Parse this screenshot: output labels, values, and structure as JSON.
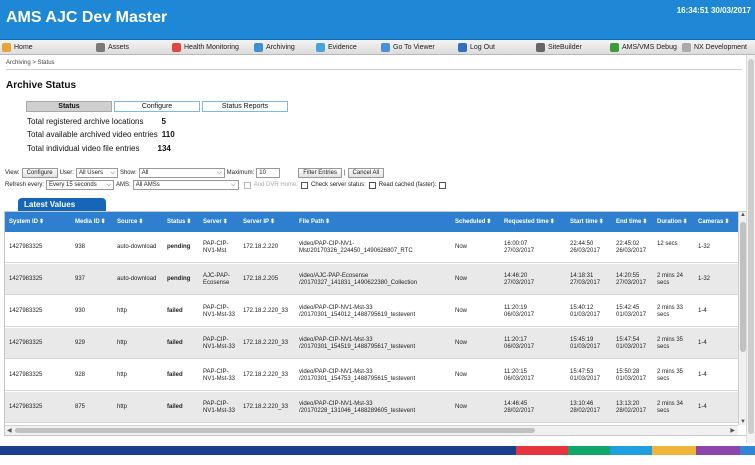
{
  "app": {
    "title": "AMS AJC Dev Master",
    "clock": "16:34:51 30/03/2017"
  },
  "nav": [
    {
      "label": "Home",
      "icon": "home-icon",
      "color": "#e8a33a"
    },
    {
      "label": "Assets",
      "icon": "assets-icon",
      "color": "#7a7a7a"
    },
    {
      "label": "Health Monitoring",
      "icon": "heart-icon",
      "color": "#e2463f"
    },
    {
      "label": "Archiving",
      "icon": "archive-icon",
      "color": "#3d8fd6"
    },
    {
      "label": "Evidence",
      "icon": "evidence-icon",
      "color": "#4aa3df"
    },
    {
      "label": "Go To Viewer",
      "icon": "viewer-icon",
      "color": "#4a90d9"
    },
    {
      "label": "Log Out",
      "icon": "logout-icon",
      "color": "#2e6fbf"
    },
    {
      "label": "SiteBuilder",
      "icon": "sitebuilder-icon",
      "color": "#666666"
    },
    {
      "label": "AMS/VMS Debug",
      "icon": "debug-icon",
      "color": "#3c9c3c"
    },
    {
      "label": "NX Development",
      "icon": "nx-icon",
      "color": "#aaaaaa"
    }
  ],
  "breadcrumb": "Archiving > Status",
  "page_title": "Archive Status",
  "tabs": [
    {
      "label": "Status",
      "active": true
    },
    {
      "label": "Configure",
      "active": false
    },
    {
      "label": "Status Reports",
      "active": false
    }
  ],
  "stats": [
    {
      "label": "Total registered archive locations",
      "value": "5"
    },
    {
      "label": "Total available archived video entries",
      "value": "110"
    },
    {
      "label": "Total individual video file entries",
      "value": "134"
    }
  ],
  "filters": {
    "view_label": "View:",
    "configure_button": "Configure",
    "user_label": "User:",
    "user_value": "All Users",
    "show_label": "Show:",
    "show_value": "All",
    "maximum_label": "Maximum:",
    "maximum_value": "10",
    "filter_button": "Filter Entries",
    "separator": "|",
    "cancel_button": "Cancel All",
    "refresh_label": "Refresh every:",
    "refresh_value": "Every 15 seconds",
    "ams_label": "AMS:",
    "ams_value": "All AMSs",
    "dvr_label": "And DVR Home:",
    "check_label": "Check server status:",
    "cached_label": "Read cached (faster):"
  },
  "panel_title": "Latest Values",
  "table": {
    "columns": [
      "System ID",
      "Media ID",
      "Source",
      "Status",
      "Server",
      "Server IP",
      "File Path",
      "Scheduled",
      "Requested time",
      "Start time",
      "End time",
      "Duration",
      "Cameras"
    ],
    "rows": [
      {
        "system_id": "1427983325",
        "media_id": "938",
        "source": "auto-download",
        "status": "pending",
        "server": [
          "PAP-CIP-",
          "NV1-Mst"
        ],
        "server_ip": "172.18.2.220",
        "file_path": [
          "video/PAP-CIP-NV1-",
          "Mst/20170326_224450_1490626807_RTC"
        ],
        "scheduled": "Now",
        "requested": [
          "16:00:07",
          "27/03/2017"
        ],
        "start": [
          "22:44:50",
          "26/03/2017"
        ],
        "end": [
          "22:45:02",
          "26/03/2017"
        ],
        "duration": [
          "12 secs",
          ""
        ],
        "cameras": "1-32"
      },
      {
        "system_id": "1427983325",
        "media_id": "937",
        "source": "auto-download",
        "status": "pending",
        "server": [
          "AJC-PAP-",
          "Ecosense"
        ],
        "server_ip": "172.18.2.205",
        "file_path": [
          "video/AJC-PAP-Ecosense",
          "/20170327_141831_1490622380_Collection"
        ],
        "scheduled": "Now",
        "requested": [
          "14:46:20",
          "27/03/2017"
        ],
        "start": [
          "14:18:31",
          "27/03/2017"
        ],
        "end": [
          "14:20:55",
          "27/03/2017"
        ],
        "duration": [
          "2 mins 24",
          "secs"
        ],
        "cameras": "1-32"
      },
      {
        "system_id": "1427983325",
        "media_id": "930",
        "source": "http",
        "status": "failed",
        "server": [
          "PAP-CIP-",
          "NV1-Mst-33"
        ],
        "server_ip": "172.18.2.220_33",
        "file_path": [
          "video/PAP-CIP-NV1-Mst-33",
          "/20170301_154012_1488795619_testevent"
        ],
        "scheduled": "Now",
        "requested": [
          "11:20:19",
          "06/03/2017"
        ],
        "start": [
          "15:40:12",
          "01/03/2017"
        ],
        "end": [
          "15:42:45",
          "01/03/2017"
        ],
        "duration": [
          "2 mins 33",
          "secs"
        ],
        "cameras": "1-4"
      },
      {
        "system_id": "1427983325",
        "media_id": "929",
        "source": "http",
        "status": "failed",
        "server": [
          "PAP-CIP-",
          "NV1-Mst-33"
        ],
        "server_ip": "172.18.2.220_33",
        "file_path": [
          "video/PAP-CIP-NV1-Mst-33",
          "/20170301_154519_1488795617_testevent"
        ],
        "scheduled": "Now",
        "requested": [
          "11:20:17",
          "06/03/2017"
        ],
        "start": [
          "15:45:19",
          "01/03/2017"
        ],
        "end": [
          "15:47:54",
          "01/03/2017"
        ],
        "duration": [
          "2 mins 35",
          "secs"
        ],
        "cameras": "1-4"
      },
      {
        "system_id": "1427983325",
        "media_id": "928",
        "source": "http",
        "status": "failed",
        "server": [
          "PAP-CIP-",
          "NV1-Mst-33"
        ],
        "server_ip": "172.18.2.220_33",
        "file_path": [
          "video/PAP-CIP-NV1-Mst-33",
          "/20170301_154753_1488795615_testevent"
        ],
        "scheduled": "Now",
        "requested": [
          "11:20:15",
          "06/03/2017"
        ],
        "start": [
          "15:47:53",
          "01/03/2017"
        ],
        "end": [
          "15:50:28",
          "01/03/2017"
        ],
        "duration": [
          "2 mins 35",
          "secs"
        ],
        "cameras": "1-4"
      },
      {
        "system_id": "1427983325",
        "media_id": "875",
        "source": "http",
        "status": "failed",
        "server": [
          "PAP-CIP-",
          "NV1-Mst-33"
        ],
        "server_ip": "172.18.2.220_33",
        "file_path": [
          "video/PAP-CIP-NV1-Mst-33",
          "/20170228_131046_1488289605_testevent"
        ],
        "scheduled": "Now",
        "requested": [
          "14:46:45",
          "28/02/2017"
        ],
        "start": [
          "13:10:46",
          "28/02/2017"
        ],
        "end": [
          "13:13:20",
          "28/02/2017"
        ],
        "duration": [
          "2 mins 34",
          "secs"
        ],
        "cameras": "1-4"
      }
    ]
  },
  "footer_colors": [
    "#e6343c",
    "#10a66c",
    "#1f9fe0",
    "#f0b43c",
    "#8e44ad",
    "#2f86d6"
  ]
}
